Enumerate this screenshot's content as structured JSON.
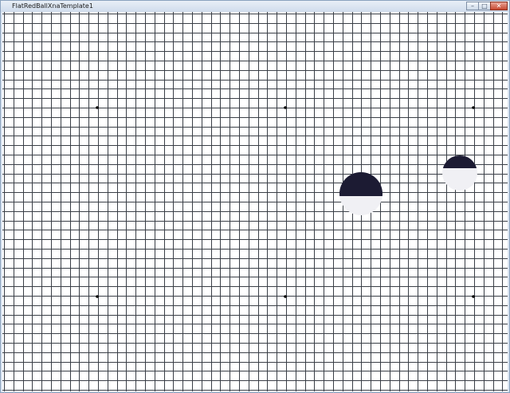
{
  "window": {
    "title": "FlatRedBallXnaTemplate1",
    "buttons": {
      "minimize_glyph": "–",
      "maximize_glyph": "□",
      "close_glyph": "✕"
    }
  },
  "scene": {
    "background_color": "#ffffff",
    "grid_line_color": "#3a3f47",
    "marker_color": "#000000",
    "sprite_dark_color": "#1c1b33",
    "sprite_light_color": "#f0f0f4"
  }
}
